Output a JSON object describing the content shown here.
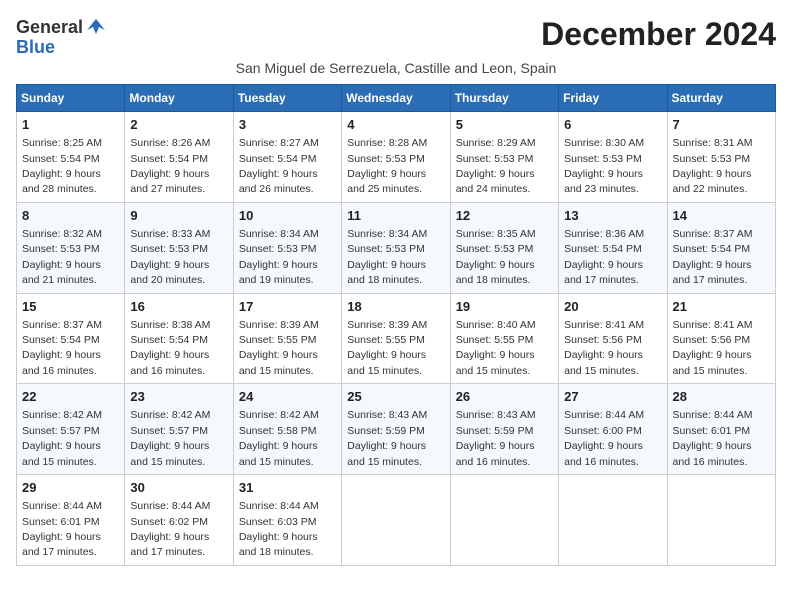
{
  "logo": {
    "general": "General",
    "blue": "Blue"
  },
  "title": "December 2024",
  "location": "San Miguel de Serrezuela, Castille and Leon, Spain",
  "days_of_week": [
    "Sunday",
    "Monday",
    "Tuesday",
    "Wednesday",
    "Thursday",
    "Friday",
    "Saturday"
  ],
  "weeks": [
    [
      {
        "day": 1,
        "sunrise": "8:25 AM",
        "sunset": "5:54 PM",
        "daylight": "9 hours and 28 minutes."
      },
      {
        "day": 2,
        "sunrise": "8:26 AM",
        "sunset": "5:54 PM",
        "daylight": "9 hours and 27 minutes."
      },
      {
        "day": 3,
        "sunrise": "8:27 AM",
        "sunset": "5:54 PM",
        "daylight": "9 hours and 26 minutes."
      },
      {
        "day": 4,
        "sunrise": "8:28 AM",
        "sunset": "5:53 PM",
        "daylight": "9 hours and 25 minutes."
      },
      {
        "day": 5,
        "sunrise": "8:29 AM",
        "sunset": "5:53 PM",
        "daylight": "9 hours and 24 minutes."
      },
      {
        "day": 6,
        "sunrise": "8:30 AM",
        "sunset": "5:53 PM",
        "daylight": "9 hours and 23 minutes."
      },
      {
        "day": 7,
        "sunrise": "8:31 AM",
        "sunset": "5:53 PM",
        "daylight": "9 hours and 22 minutes."
      }
    ],
    [
      {
        "day": 8,
        "sunrise": "8:32 AM",
        "sunset": "5:53 PM",
        "daylight": "9 hours and 21 minutes."
      },
      {
        "day": 9,
        "sunrise": "8:33 AM",
        "sunset": "5:53 PM",
        "daylight": "9 hours and 20 minutes."
      },
      {
        "day": 10,
        "sunrise": "8:34 AM",
        "sunset": "5:53 PM",
        "daylight": "9 hours and 19 minutes."
      },
      {
        "day": 11,
        "sunrise": "8:34 AM",
        "sunset": "5:53 PM",
        "daylight": "9 hours and 18 minutes."
      },
      {
        "day": 12,
        "sunrise": "8:35 AM",
        "sunset": "5:53 PM",
        "daylight": "9 hours and 18 minutes."
      },
      {
        "day": 13,
        "sunrise": "8:36 AM",
        "sunset": "5:54 PM",
        "daylight": "9 hours and 17 minutes."
      },
      {
        "day": 14,
        "sunrise": "8:37 AM",
        "sunset": "5:54 PM",
        "daylight": "9 hours and 17 minutes."
      }
    ],
    [
      {
        "day": 15,
        "sunrise": "8:37 AM",
        "sunset": "5:54 PM",
        "daylight": "9 hours and 16 minutes."
      },
      {
        "day": 16,
        "sunrise": "8:38 AM",
        "sunset": "5:54 PM",
        "daylight": "9 hours and 16 minutes."
      },
      {
        "day": 17,
        "sunrise": "8:39 AM",
        "sunset": "5:55 PM",
        "daylight": "9 hours and 15 minutes."
      },
      {
        "day": 18,
        "sunrise": "8:39 AM",
        "sunset": "5:55 PM",
        "daylight": "9 hours and 15 minutes."
      },
      {
        "day": 19,
        "sunrise": "8:40 AM",
        "sunset": "5:55 PM",
        "daylight": "9 hours and 15 minutes."
      },
      {
        "day": 20,
        "sunrise": "8:41 AM",
        "sunset": "5:56 PM",
        "daylight": "9 hours and 15 minutes."
      },
      {
        "day": 21,
        "sunrise": "8:41 AM",
        "sunset": "5:56 PM",
        "daylight": "9 hours and 15 minutes."
      }
    ],
    [
      {
        "day": 22,
        "sunrise": "8:42 AM",
        "sunset": "5:57 PM",
        "daylight": "9 hours and 15 minutes."
      },
      {
        "day": 23,
        "sunrise": "8:42 AM",
        "sunset": "5:57 PM",
        "daylight": "9 hours and 15 minutes."
      },
      {
        "day": 24,
        "sunrise": "8:42 AM",
        "sunset": "5:58 PM",
        "daylight": "9 hours and 15 minutes."
      },
      {
        "day": 25,
        "sunrise": "8:43 AM",
        "sunset": "5:59 PM",
        "daylight": "9 hours and 15 minutes."
      },
      {
        "day": 26,
        "sunrise": "8:43 AM",
        "sunset": "5:59 PM",
        "daylight": "9 hours and 16 minutes."
      },
      {
        "day": 27,
        "sunrise": "8:44 AM",
        "sunset": "6:00 PM",
        "daylight": "9 hours and 16 minutes."
      },
      {
        "day": 28,
        "sunrise": "8:44 AM",
        "sunset": "6:01 PM",
        "daylight": "9 hours and 16 minutes."
      }
    ],
    [
      {
        "day": 29,
        "sunrise": "8:44 AM",
        "sunset": "6:01 PM",
        "daylight": "9 hours and 17 minutes."
      },
      {
        "day": 30,
        "sunrise": "8:44 AM",
        "sunset": "6:02 PM",
        "daylight": "9 hours and 17 minutes."
      },
      {
        "day": 31,
        "sunrise": "8:44 AM",
        "sunset": "6:03 PM",
        "daylight": "9 hours and 18 minutes."
      },
      null,
      null,
      null,
      null
    ]
  ]
}
